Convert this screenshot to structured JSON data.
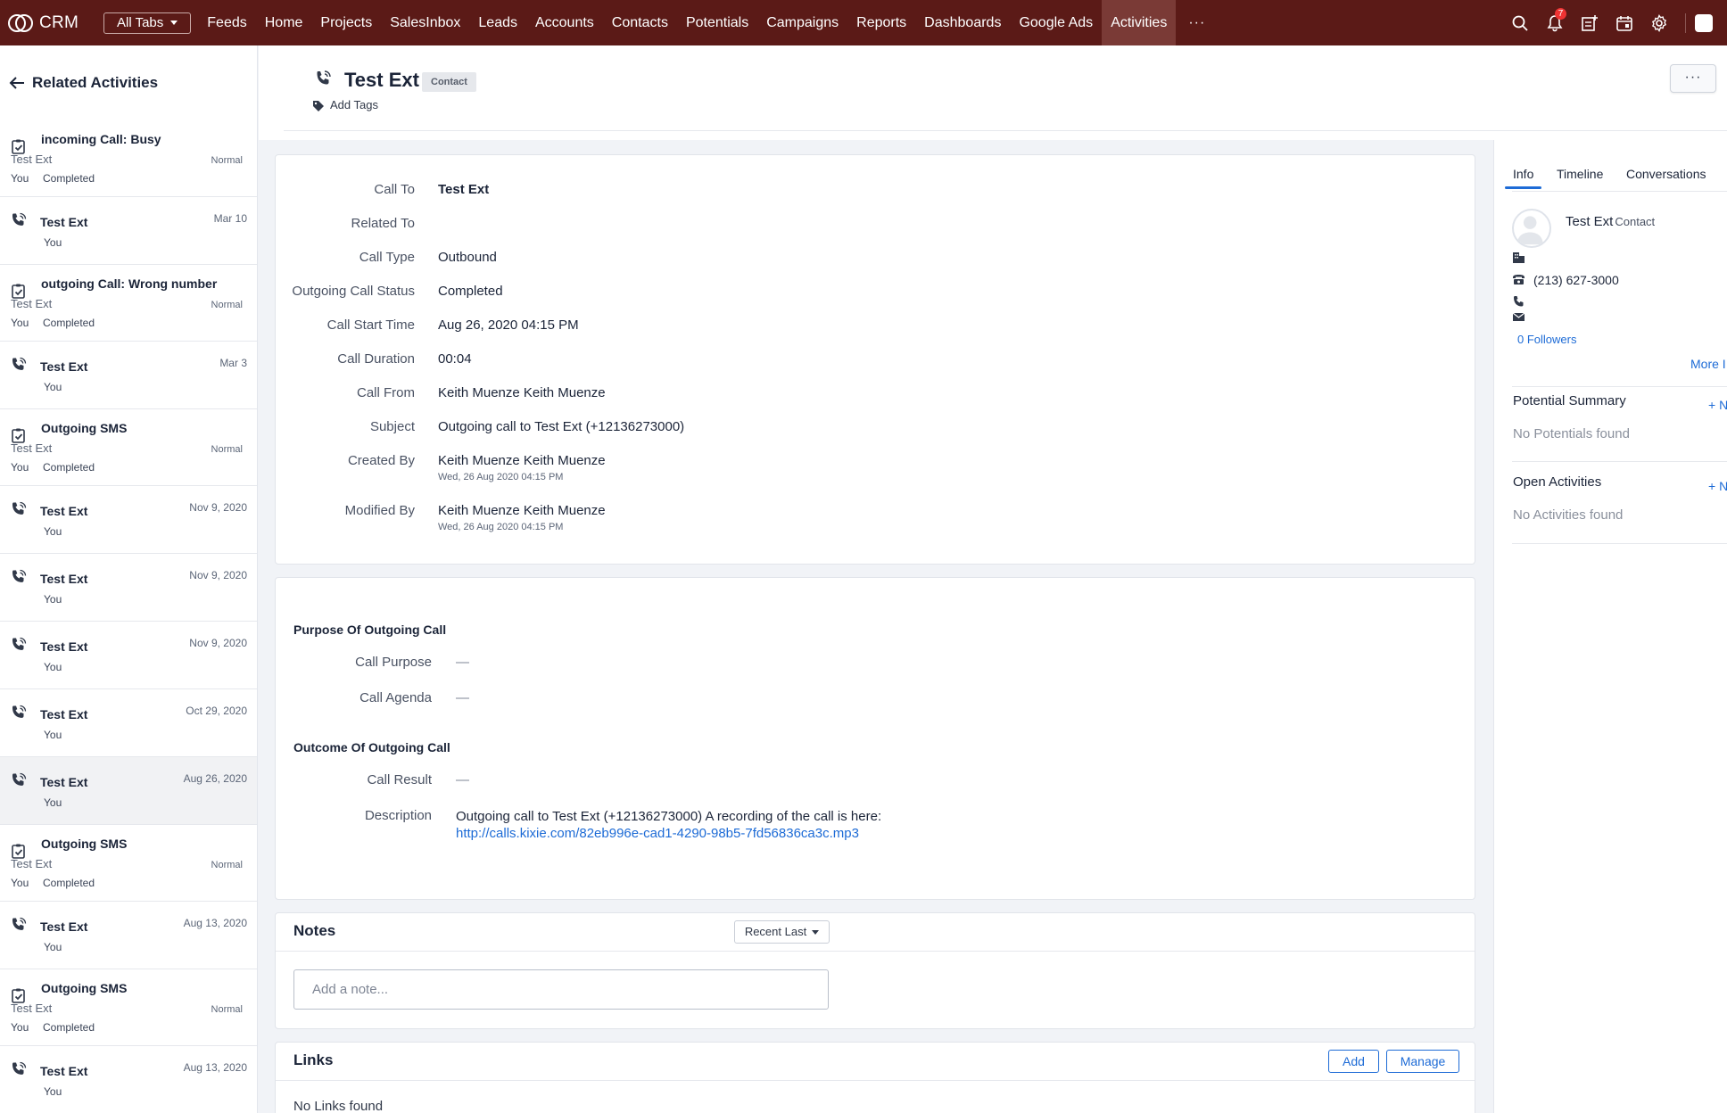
{
  "topbar": {
    "logo": "CRM",
    "all_tabs": "All Tabs",
    "nav": [
      "Feeds",
      "Home",
      "Projects",
      "SalesInbox",
      "Leads",
      "Accounts",
      "Contacts",
      "Potentials",
      "Campaigns",
      "Reports",
      "Dashboards",
      "Google Ads",
      "Activities"
    ],
    "active_nav": "Activities",
    "more": "···",
    "notification_count": "7",
    "bg_color": "#5b1a17"
  },
  "sidebar": {
    "title": "Related Activities",
    "items": [
      {
        "kind": "task",
        "title": "incoming Call: Busy",
        "sub": "Test Ext",
        "priority": "Normal",
        "owner": "You",
        "status": "Completed"
      },
      {
        "kind": "call",
        "title": "Test Ext",
        "date": "Mar 10",
        "owner": "You"
      },
      {
        "kind": "task",
        "title": "outgoing Call: Wrong number",
        "sub": "Test Ext",
        "priority": "Normal",
        "owner": "You",
        "status": "Completed"
      },
      {
        "kind": "call",
        "title": "Test Ext",
        "date": "Mar 3",
        "owner": "You"
      },
      {
        "kind": "task",
        "title": "Outgoing SMS",
        "sub": "Test Ext",
        "priority": "Normal",
        "owner": "You",
        "status": "Completed"
      },
      {
        "kind": "call",
        "title": "Test Ext",
        "date": "Nov 9, 2020",
        "owner": "You"
      },
      {
        "kind": "call",
        "title": "Test Ext",
        "date": "Nov 9, 2020",
        "owner": "You"
      },
      {
        "kind": "call",
        "title": "Test Ext",
        "date": "Nov 9, 2020",
        "owner": "You"
      },
      {
        "kind": "call",
        "title": "Test Ext",
        "date": "Oct 29, 2020",
        "owner": "You"
      },
      {
        "kind": "call",
        "title": "Test Ext",
        "date": "Aug 26, 2020",
        "owner": "You",
        "selected": true
      },
      {
        "kind": "task",
        "title": "Outgoing SMS",
        "sub": "Test Ext",
        "priority": "Normal",
        "owner": "You",
        "status": "Completed"
      },
      {
        "kind": "call",
        "title": "Test Ext",
        "date": "Aug 13, 2020",
        "owner": "You"
      },
      {
        "kind": "task",
        "title": "Outgoing SMS",
        "sub": "Test Ext",
        "priority": "Normal",
        "owner": "You",
        "status": "Completed"
      },
      {
        "kind": "call",
        "title": "Test Ext",
        "date": "Aug 13, 2020",
        "owner": "You"
      }
    ]
  },
  "record": {
    "title": "Test Ext",
    "badge": "Contact",
    "add_tags": "Add Tags",
    "more": "···"
  },
  "details": {
    "call_to_label": "Call To",
    "call_to": "Test Ext",
    "related_to_label": "Related To",
    "related_to": "",
    "call_type_label": "Call Type",
    "call_type": "Outbound",
    "status_label": "Outgoing Call Status",
    "status": "Completed",
    "start_label": "Call Start Time",
    "start": "Aug 26, 2020 04:15 PM",
    "duration_label": "Call Duration",
    "duration": "00:04",
    "from_label": "Call From",
    "from": "Keith Muenze Keith Muenze",
    "subject_label": "Subject",
    "subject": "Outgoing call to Test Ext (+12136273000)",
    "created_label": "Created By",
    "created_by": "Keith Muenze Keith Muenze",
    "created_at": "Wed, 26 Aug 2020 04:15 PM",
    "modified_label": "Modified By",
    "modified_by": "Keith Muenze Keith Muenze",
    "modified_at": "Wed, 26 Aug 2020 04:15 PM"
  },
  "purpose": {
    "section": "Purpose Of Outgoing Call",
    "purpose_label": "Call Purpose",
    "purpose": "—",
    "agenda_label": "Call Agenda",
    "agenda": "—"
  },
  "outcome": {
    "section": "Outcome Of Outgoing Call",
    "result_label": "Call Result",
    "result": "—",
    "description_label": "Description",
    "description": "Outgoing call to Test Ext (+12136273000) A recording of the call is here:",
    "link": "http://calls.kixie.com/82eb996e-cad1-4290-98b5-7fd56836ca3c.mp3"
  },
  "notes": {
    "title": "Notes",
    "sort": "Recent Last",
    "placeholder": "Add a note..."
  },
  "links": {
    "title": "Links",
    "add": "Add",
    "manage": "Manage",
    "empty": "No Links found"
  },
  "rpanel": {
    "tabs": [
      "Info",
      "Timeline",
      "Conversations"
    ],
    "active_tab": "Info",
    "name": "Test Ext",
    "type": "Contact",
    "phone": "(213) 627-3000",
    "followers": "0 Followers",
    "more_info": "More I",
    "potential_title": "Potential Summary",
    "potential_add": "+ N",
    "potential_empty": "No Potentials found",
    "activities_title": "Open Activities",
    "activities_add": "+ N",
    "activities_empty": "No Activities found",
    "link_color": "#1d6bd6"
  }
}
